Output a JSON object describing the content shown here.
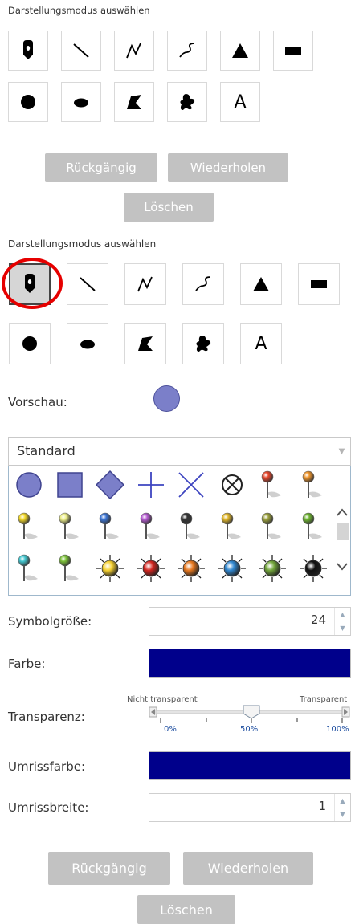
{
  "panel1": {
    "heading": "Darstellungsmodus auswählen",
    "undo": "Rückgängig",
    "redo": "Wiederholen",
    "clear": "Löschen"
  },
  "panel2": {
    "heading": "Darstellungsmodus auswählen",
    "undo": "Rückgängig",
    "redo": "Wiederholen",
    "clear": "Löschen"
  },
  "tools": [
    {
      "name": "point-tool",
      "icon": "marker-pin-icon"
    },
    {
      "name": "line-tool",
      "icon": "line-icon"
    },
    {
      "name": "polyline-tool",
      "icon": "polyline-icon"
    },
    {
      "name": "freehand-line-tool",
      "icon": "freehand-line-icon"
    },
    {
      "name": "triangle-tool",
      "icon": "triangle-icon"
    },
    {
      "name": "rectangle-tool",
      "icon": "rectangle-icon"
    },
    {
      "name": "circle-tool",
      "icon": "circle-icon"
    },
    {
      "name": "ellipse-tool",
      "icon": "ellipse-icon"
    },
    {
      "name": "polygon-tool",
      "icon": "polygon-icon"
    },
    {
      "name": "freehand-polygon-tool",
      "icon": "freehand-polygon-icon"
    },
    {
      "name": "text-tool",
      "icon": "text-icon",
      "glyph": "A"
    }
  ],
  "selected_tool": "point-tool",
  "preview": {
    "label": "Vorschau:",
    "color": "#7b7fc9"
  },
  "symbol_set": {
    "selected": "Standard"
  },
  "symbol_gallery": [
    {
      "name": "circle-symbol-icon",
      "kind": "circle"
    },
    {
      "name": "square-symbol-icon",
      "kind": "square"
    },
    {
      "name": "diamond-symbol-icon",
      "kind": "diamond"
    },
    {
      "name": "cross-symbol-icon",
      "kind": "cross"
    },
    {
      "name": "x-symbol-icon",
      "kind": "x"
    },
    {
      "name": "circled-x-symbol-icon",
      "kind": "circledx"
    },
    {
      "name": "red-pushpin-icon",
      "kind": "pin",
      "color": "#e8452a"
    },
    {
      "name": "orange-pushpin-icon",
      "kind": "pin",
      "color": "#f0952a"
    },
    {
      "name": "yellow-pushpin-icon",
      "kind": "pin",
      "color": "#f2d827"
    },
    {
      "name": "light-yellow-pushpin-icon",
      "kind": "pin",
      "color": "#eef08a"
    },
    {
      "name": "blue-pushpin-icon",
      "kind": "pin",
      "color": "#3b74d4"
    },
    {
      "name": "purple-pushpin-icon",
      "kind": "pin",
      "color": "#b45ad0"
    },
    {
      "name": "black-pushpin-icon",
      "kind": "pin",
      "color": "#333333"
    },
    {
      "name": "gold-pushpin-icon",
      "kind": "pin",
      "color": "#e0b62a"
    },
    {
      "name": "olive-pushpin-icon",
      "kind": "pin",
      "color": "#9aa03c"
    },
    {
      "name": "green-pushpin-icon",
      "kind": "pin",
      "color": "#6cb32e"
    },
    {
      "name": "cyan-pushpin-icon",
      "kind": "pin",
      "color": "#41c7d0"
    },
    {
      "name": "lime-pushpin-icon",
      "kind": "pin",
      "color": "#7cc238"
    },
    {
      "name": "yellow-sun-icon",
      "kind": "sun",
      "color": "#f7d12e"
    },
    {
      "name": "red-sun-icon",
      "kind": "sun",
      "color": "#d4241e"
    },
    {
      "name": "orange-sun-icon",
      "kind": "sun",
      "color": "#e7771d"
    },
    {
      "name": "blue-sun-icon",
      "kind": "sun",
      "color": "#2f86cf"
    },
    {
      "name": "green-sun-icon",
      "kind": "sun",
      "color": "#71a53a"
    },
    {
      "name": "black-sun-icon",
      "kind": "sun",
      "color": "#111111"
    }
  ],
  "symbol_size": {
    "label": "Symbolgröße:",
    "value": "24"
  },
  "fill_color": {
    "label": "Farbe:",
    "value": "#00008b"
  },
  "transparency": {
    "label": "Transparenz:",
    "left_caption": "Nicht transparent",
    "right_caption": "Transparent",
    "ticks": [
      "0%",
      "50%",
      "100%"
    ],
    "value_percent": 50
  },
  "outline_color": {
    "label": "Umrissfarbe:",
    "value": "#00008b"
  },
  "outline_width": {
    "label": "Umrissbreite:",
    "value": "1"
  },
  "disabled_button_color": "#c2c2c2"
}
